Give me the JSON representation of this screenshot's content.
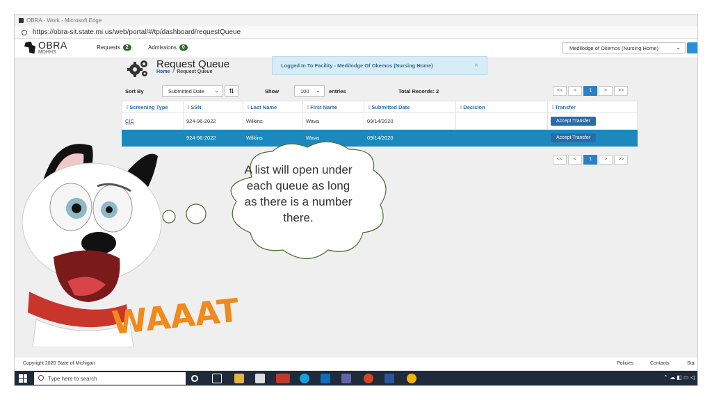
{
  "browser": {
    "window_title": "OBRA - Work - Microsoft Edge",
    "url": "https://obra-sit.state.mi.us/web/portal/#/tp/dashboard/requestQueue"
  },
  "app": {
    "logo_title": "OBRA",
    "logo_subtitle": "MDHHS",
    "nav": [
      {
        "label": "Requests",
        "count": "2"
      },
      {
        "label": "Admissions",
        "count": "0"
      }
    ],
    "facility_select": "Medilodge of Okemos (Nursing Home)"
  },
  "page": {
    "title": "Request Queue",
    "breadcrumb_home": "Home",
    "breadcrumb_sep": "/",
    "breadcrumb_current": "Request Queue",
    "toast": "Logged In To Facility - Medilodge Of Okemos (Nursing Home)",
    "toast_close": "×"
  },
  "controls": {
    "sort_label": "Sort By",
    "sort_value": "Submitted Date",
    "show_label": "Show",
    "show_value": "100",
    "entries_label": "entries",
    "total_label": "Total Records:",
    "total_value": "2"
  },
  "pager": [
    "<<",
    "<",
    "1",
    ">",
    ">>"
  ],
  "table": {
    "columns": [
      "Screening Type",
      "SSN",
      "Last Name",
      "First Name",
      "Submitted Date",
      "Decision",
      "Transfer"
    ],
    "rows": [
      {
        "screening_type": "CIC",
        "ssn": "924-96-2022",
        "last_name": "Wilkins",
        "first_name": "Wava",
        "submitted": "09/14/2020",
        "decision": "",
        "action": "Accept Transfer"
      },
      {
        "screening_type": "",
        "ssn": "924-96-2022",
        "last_name": "Wilkins",
        "first_name": "Wava",
        "submitted": "09/14/2020",
        "decision": "",
        "action": "Accept Transfer"
      }
    ]
  },
  "footer": {
    "copyright": "Copyright 2020 State of Michigan",
    "links": [
      "Policies",
      "Contacts",
      "Sta"
    ]
  },
  "taskbar": {
    "search_placeholder": "Type here to search"
  },
  "annotation": {
    "thought_text": "A list will open under each queue as long as there is a number there.",
    "exclaim": "WAAAT"
  },
  "colors": {
    "selected_row": "#1b89bd",
    "accent_blue": "#2b7fc4",
    "badge_green": "#2d6a2d",
    "exclaim_orange": "#f08a1c",
    "taskbar": "#1f2a3a"
  }
}
